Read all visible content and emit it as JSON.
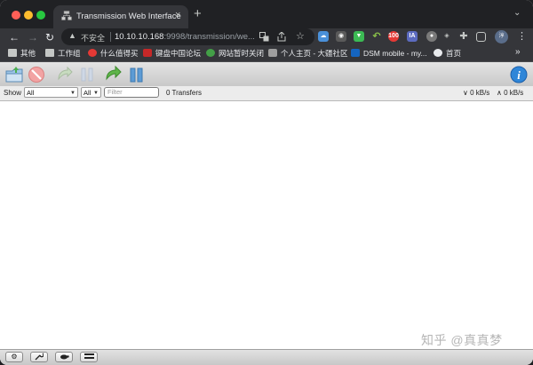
{
  "browser": {
    "tab": {
      "title": "Transmission Web Interface",
      "close_icon": "×"
    },
    "newtab_icon": "+",
    "tabs_menu_icon": "⌄",
    "nav": {
      "back": "←",
      "forward": "→",
      "reload": "↻"
    },
    "omnibox": {
      "warning_icon": "▲",
      "insecure_label": "不安全",
      "url_host": "10.10.10.168",
      "url_rest": ":9998/transmission/we..."
    },
    "profile_initial": "淳",
    "menu_icon": "⋮",
    "extensions": [
      "translate-icon",
      "share-icon",
      "star-icon"
    ]
  },
  "bookmarks": [
    {
      "label": "其他",
      "icon": "folder-icon"
    },
    {
      "label": "工作组",
      "icon": "folder-icon"
    },
    {
      "label": "什么值得买",
      "icon": "smzdm-icon"
    },
    {
      "label": "键盘中国论坛",
      "icon": "keyboard-icon"
    },
    {
      "label": "网站暂时关闭",
      "icon": "leaf-icon"
    },
    {
      "label": "个人主页 - 大疆社区",
      "icon": "dji-icon"
    },
    {
      "label": "DSM mobile - my...",
      "icon": "dsm-icon"
    },
    {
      "label": "首页",
      "icon": "github-icon"
    }
  ],
  "bookmarks_more": "»",
  "app": {
    "filter": {
      "show_label": "Show",
      "state_selected": "All",
      "tracker_selected": "All",
      "filter_placeholder": "Filter",
      "transfers_count": "0 Transfers",
      "download_speed": "∨ 0 kB/s",
      "upload_speed": "∧ 0 kB/s"
    },
    "footer": {
      "settings_icon": "⚙",
      "wrench_icon": "🔧",
      "turtle_icon": "turtle",
      "compact_icon": "▭"
    }
  },
  "watermark": "知乎 @真真梦"
}
